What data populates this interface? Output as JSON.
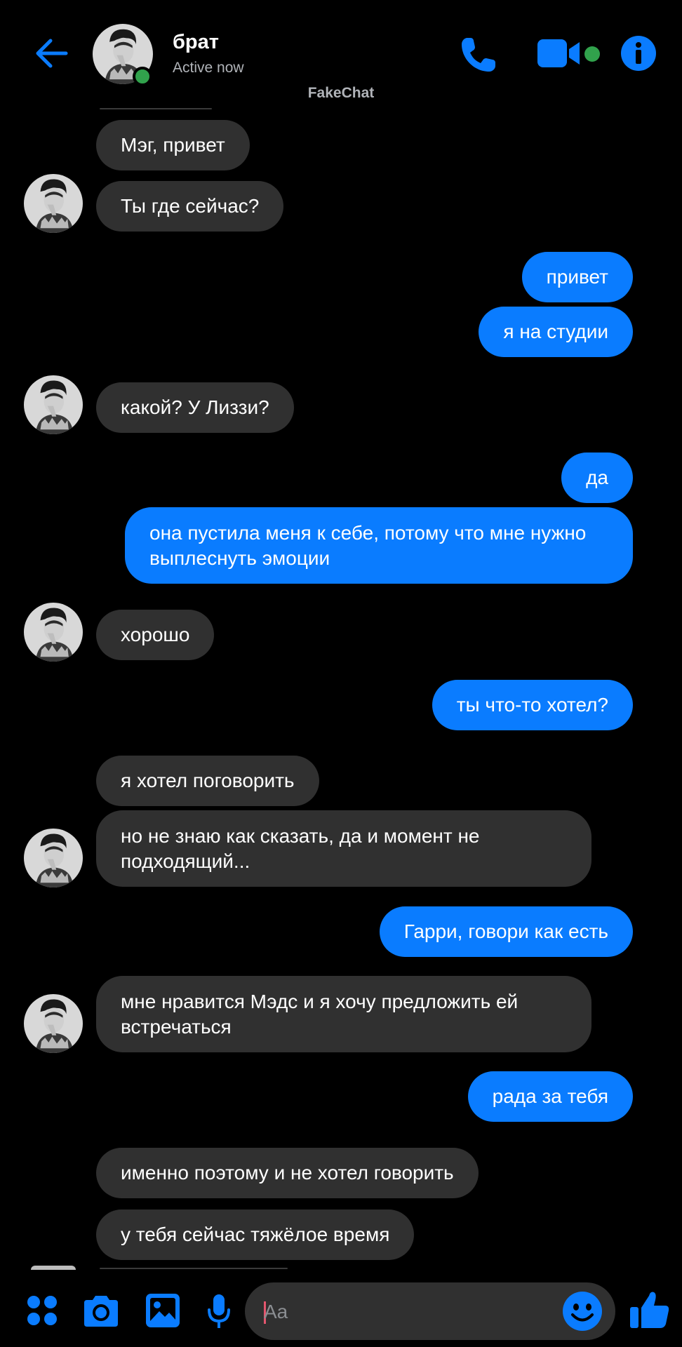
{
  "header": {
    "title": "брат",
    "status": "Active now",
    "watermark": "FakeChat"
  },
  "messages": [
    {
      "side": "in",
      "text": "Мэг, привет"
    },
    {
      "side": "in",
      "text": "Ты где сейчас?"
    },
    {
      "side": "out",
      "text": "привет"
    },
    {
      "side": "out",
      "text": "я на студии"
    },
    {
      "side": "in",
      "text": "какой? У Лиззи?"
    },
    {
      "side": "out",
      "text": "да"
    },
    {
      "side": "out",
      "text": "она пустила меня к себе, потому что мне нужно  выплеснуть эмоции"
    },
    {
      "side": "in",
      "text": "хорошо"
    },
    {
      "side": "out",
      "text": "ты что-то хотел?"
    },
    {
      "side": "in",
      "text": "я хотел поговорить"
    },
    {
      "side": "in",
      "text": "но не знаю как сказать,  да и момент не подходящий..."
    },
    {
      "side": "out",
      "text": "Гарри, говори как есть"
    },
    {
      "side": "in",
      "text": "мне нравится Мэдс и я хочу предложить ей встречаться"
    },
    {
      "side": "out",
      "text": "рада за тебя"
    },
    {
      "side": "in",
      "text": "именно поэтому и не хотел говорить"
    },
    {
      "side": "in",
      "text": "у тебя сейчас тяжёлое время"
    }
  ],
  "composer": {
    "placeholder": "Aa"
  },
  "colors": {
    "accent": "#0a7cff",
    "incoming_bubble": "#303030",
    "online": "#31a24c",
    "background": "#000000"
  },
  "icons": [
    "back-arrow-icon",
    "phone-icon",
    "video-camera-icon",
    "info-icon",
    "apps-icon",
    "camera-icon",
    "gallery-icon",
    "microphone-icon",
    "emoji-icon",
    "thumbs-up-icon"
  ]
}
